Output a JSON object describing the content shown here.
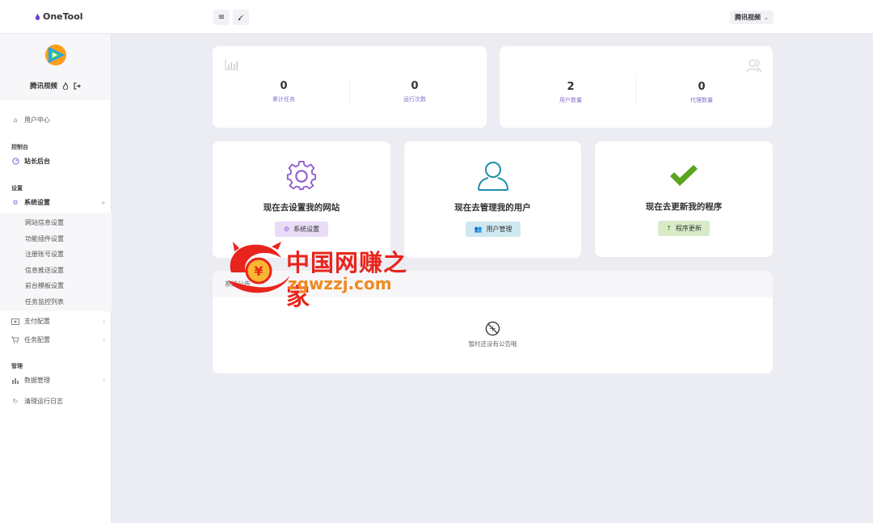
{
  "topbar": {
    "brand": "OneTool",
    "menu_icon": "menu-icon",
    "theme_icon": "brush-icon",
    "user_menu": "腾讯视频"
  },
  "sidebar": {
    "profile": {
      "name": "腾讯视频",
      "logo_icon": "tencent-video-logo"
    },
    "items": [
      {
        "label": "用户中心",
        "icon": "home-icon"
      },
      {
        "label": "站长后台",
        "icon": "gauge-icon"
      },
      {
        "label": "系统设置",
        "icon": "gear-icon"
      },
      {
        "label": "支付配置",
        "icon": "payment-icon"
      },
      {
        "label": "任务配置",
        "icon": "cart-icon"
      },
      {
        "label": "数据管理",
        "icon": "chart-icon"
      },
      {
        "label": "清理运行日志",
        "icon": "refresh-icon"
      }
    ],
    "sections": {
      "console": "控制台",
      "settings": "设置",
      "manage": "管理"
    },
    "sub_items": [
      "网站信息设置",
      "功能插件设置",
      "注册账号设置",
      "信息推送设置",
      "前台模板设置",
      "任务监控列表"
    ]
  },
  "stats": {
    "left": [
      {
        "value": "0",
        "label": "累计任务"
      },
      {
        "value": "0",
        "label": "运行次数"
      }
    ],
    "right": [
      {
        "value": "2",
        "label": "用户数量"
      },
      {
        "value": "0",
        "label": "代理数量"
      }
    ]
  },
  "actions": [
    {
      "title": "现在去设置我的网站",
      "button": "系统设置",
      "icon": "gear-icon",
      "color": "#8f5ad0",
      "btn_bg": "#e8dcf7"
    },
    {
      "title": "现在去管理我的用户",
      "button": "用户管理",
      "icon": "user-icon",
      "color": "#1e8fa8",
      "btn_bg": "#cfe8ef"
    },
    {
      "title": "现在去更新我的程序",
      "button": "程序更新",
      "icon": "check-icon",
      "color": "#5aa51f",
      "btn_bg": "#d8ebc8"
    }
  ],
  "notice": {
    "header_label": "系统公告",
    "empty_text": "暂时还没有公告哦",
    "empty_icon": "no-data-icon"
  },
  "watermark": {
    "cn": "中国网赚之家",
    "url": "zgwzzj.com"
  },
  "colors": {
    "accent": "#8a6fd0",
    "bg": "#ecedf3"
  }
}
